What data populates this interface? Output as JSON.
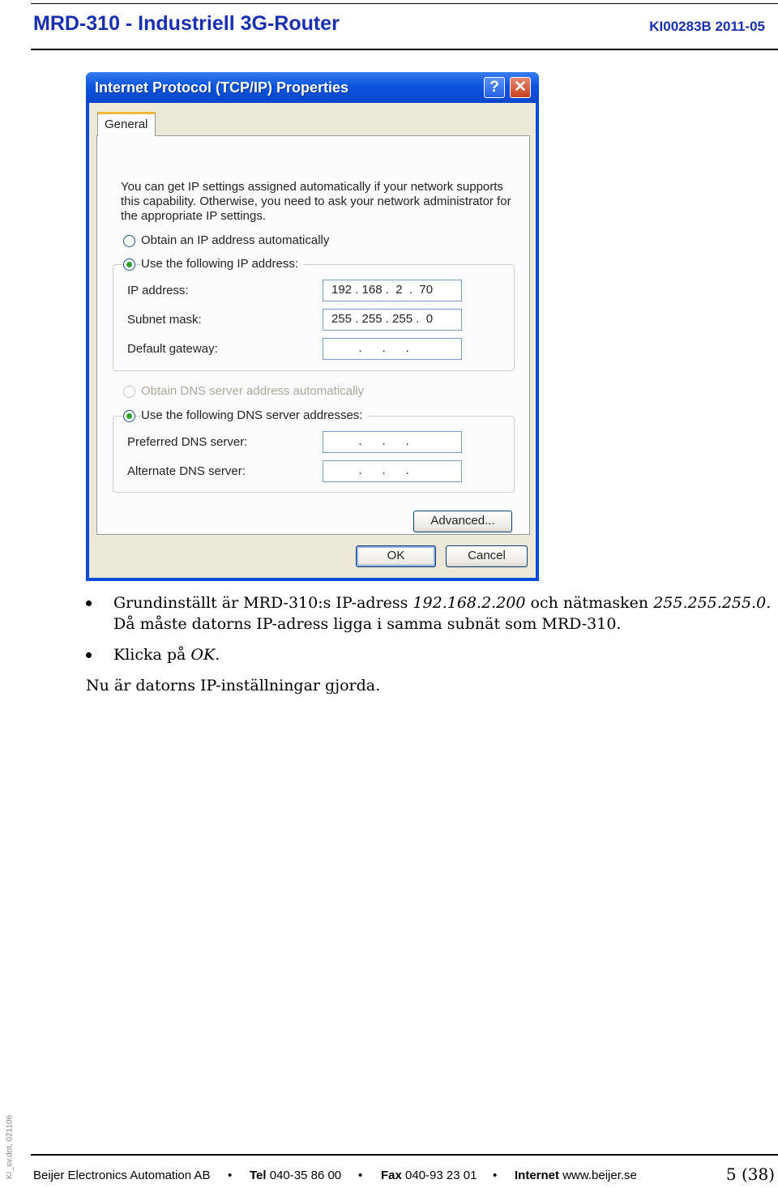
{
  "header": {
    "title": "MRD-310 - Industriell 3G-Router",
    "doc_id": "KI00283B  2011-05"
  },
  "dialog": {
    "title": "Internet Protocol (TCP/IP) Properties",
    "help_glyph": "?",
    "close_glyph": "✕",
    "tab_general": "General",
    "description": "You can get IP settings assigned automatically if your network supports this capability. Otherwise, you need to ask your network administrator for the appropriate IP settings.",
    "radio_obtain_ip": "Obtain an IP address automatically",
    "radio_use_ip": "Use the following IP address:",
    "label_ip": "IP address:",
    "label_subnet": "Subnet mask:",
    "label_gateway": "Default gateway:",
    "value_ip": "192 . 168 .  2  .  70",
    "value_subnet": "255 . 255 . 255 .  0",
    "value_gateway": "        .      .      .",
    "radio_obtain_dns": "Obtain DNS server address automatically",
    "radio_use_dns": "Use the following DNS server addresses:",
    "label_pref_dns": "Preferred DNS server:",
    "label_alt_dns": "Alternate DNS server:",
    "value_pref_dns": "        .      .      .",
    "value_alt_dns": "        .      .      .",
    "btn_advanced": "Advanced...",
    "btn_ok": "OK",
    "btn_cancel": "Cancel"
  },
  "body": {
    "b1_pre": "Grundinställt är MRD-310:s IP-adress ",
    "b1_ip": "192.168.2.200",
    "b1_mid": " och nätmasken ",
    "b1_mask": "255.255.255.0",
    "b1_end": ".",
    "b1_line2": "Då måste datorns IP-adress ligga i samma subnät som MRD-310.",
    "b2_pre": "Klicka på ",
    "b2_ok": "OK",
    "b2_end": ".",
    "closing": "Nu är datorns IP-inställningar gjorda."
  },
  "footer": {
    "side_note": "KI_sv.dot, 021106",
    "company": "Beijer Electronics Automation AB",
    "tel_label": "Tel",
    "tel": "040-35 86 00",
    "fax_label": "Fax",
    "fax": "040-93 23 01",
    "internet_label": "Internet",
    "internet": "www.beijer.se",
    "page": "5 (38)"
  }
}
